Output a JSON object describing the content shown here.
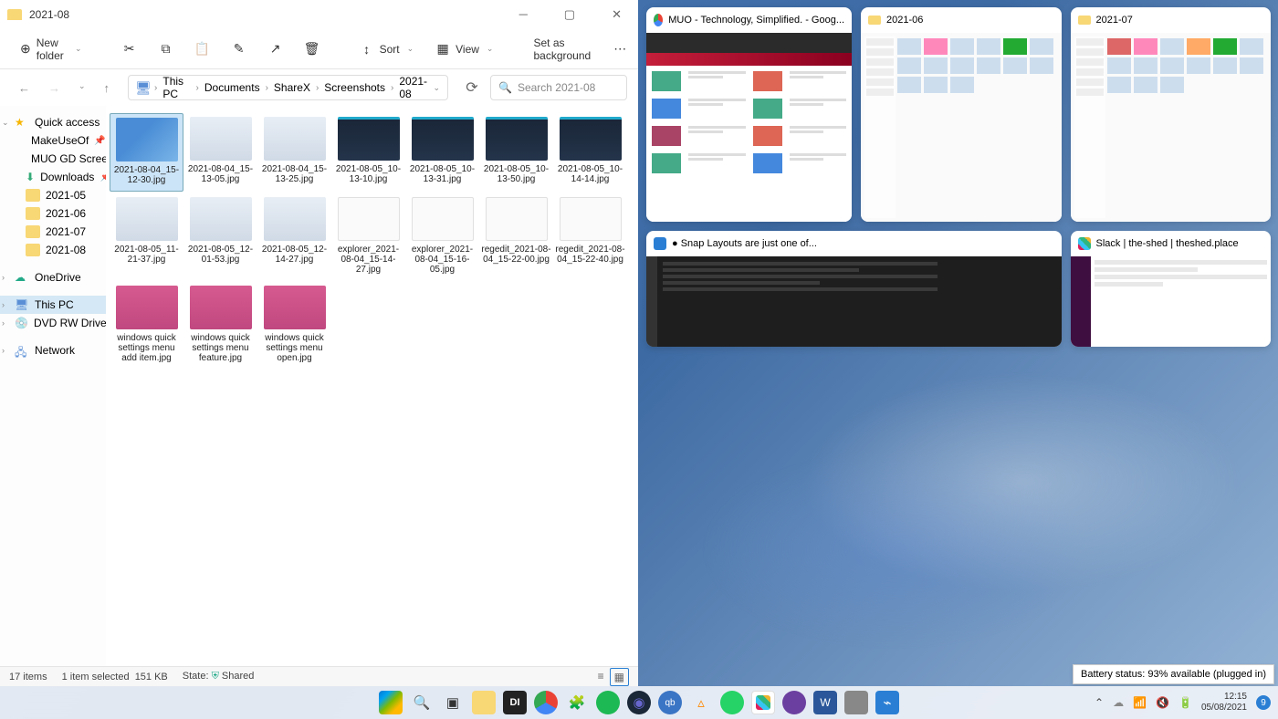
{
  "explorer": {
    "title": "2021-08",
    "toolbar": {
      "new": "New folder",
      "sort": "Sort",
      "view": "View",
      "background": "Set as background"
    },
    "nav": {
      "breadcrumbs": [
        "This PC",
        "Documents",
        "ShareX",
        "Screenshots",
        "2021-08"
      ],
      "search_placeholder": "Search 2021-08"
    },
    "sidebar": {
      "quick": "Quick access",
      "items": [
        {
          "label": "MakeUseOf",
          "pin": true,
          "kind": "red"
        },
        {
          "label": "MUO GD Scree",
          "pin": true,
          "kind": "green"
        },
        {
          "label": "Downloads",
          "pin": true,
          "kind": "dl"
        },
        {
          "label": "2021-05",
          "kind": "folder"
        },
        {
          "label": "2021-06",
          "kind": "folder"
        },
        {
          "label": "2021-07",
          "kind": "folder"
        },
        {
          "label": "2021-08",
          "kind": "folder"
        }
      ],
      "onedrive": "OneDrive",
      "thispc": "This PC",
      "dvd": "DVD RW Drive (D:) A",
      "network": "Network"
    },
    "files": [
      {
        "name": "2021-08-04_15-12-30.jpg",
        "cls": "win",
        "sel": true
      },
      {
        "name": "2021-08-04_15-13-05.jpg",
        "cls": "light"
      },
      {
        "name": "2021-08-04_15-13-25.jpg",
        "cls": "light"
      },
      {
        "name": "2021-08-05_10-13-10.jpg",
        "cls": "dark"
      },
      {
        "name": "2021-08-05_10-13-31.jpg",
        "cls": "dark"
      },
      {
        "name": "2021-08-05_10-13-50.jpg",
        "cls": "dark"
      },
      {
        "name": "2021-08-05_10-14-14.jpg",
        "cls": "dark"
      },
      {
        "name": "2021-08-05_11-21-37.jpg",
        "cls": "light"
      },
      {
        "name": "2021-08-05_12-01-53.jpg",
        "cls": "light"
      },
      {
        "name": "2021-08-05_12-14-27.jpg",
        "cls": "light"
      },
      {
        "name": "explorer_2021-08-04_15-14-27.jpg",
        "cls": "white"
      },
      {
        "name": "explorer_2021-08-04_15-16-05.jpg",
        "cls": "white"
      },
      {
        "name": "regedit_2021-08-04_15-22-00.jpg",
        "cls": "white"
      },
      {
        "name": "regedit_2021-08-04_15-22-40.jpg",
        "cls": "white"
      },
      {
        "name": "windows quick settings menu add item.jpg",
        "cls": "pink"
      },
      {
        "name": "windows quick settings menu feature.jpg",
        "cls": "pink"
      },
      {
        "name": "windows quick settings menu open.jpg",
        "cls": "pink"
      }
    ],
    "status": {
      "items": "17 items",
      "selected": "1 item selected",
      "size": "151 KB",
      "state_label": "State:",
      "state_value": "Shared"
    }
  },
  "snap": {
    "cards": [
      {
        "app": "chrome",
        "title": "MUO - Technology, Simplified. - Goog..."
      },
      {
        "app": "folder",
        "title": "2021-06"
      },
      {
        "app": "folder",
        "title": "2021-07"
      },
      {
        "app": "vscode",
        "title": "● Snap Layouts are just one of..."
      },
      {
        "app": "slack",
        "title": "Slack | the-shed | theshed.place"
      }
    ]
  },
  "battery_tooltip": "Battery status: 93% available (plugged in)",
  "taskbar": {
    "time": "12:15",
    "date": "05/08/2021",
    "notif_count": "9"
  }
}
